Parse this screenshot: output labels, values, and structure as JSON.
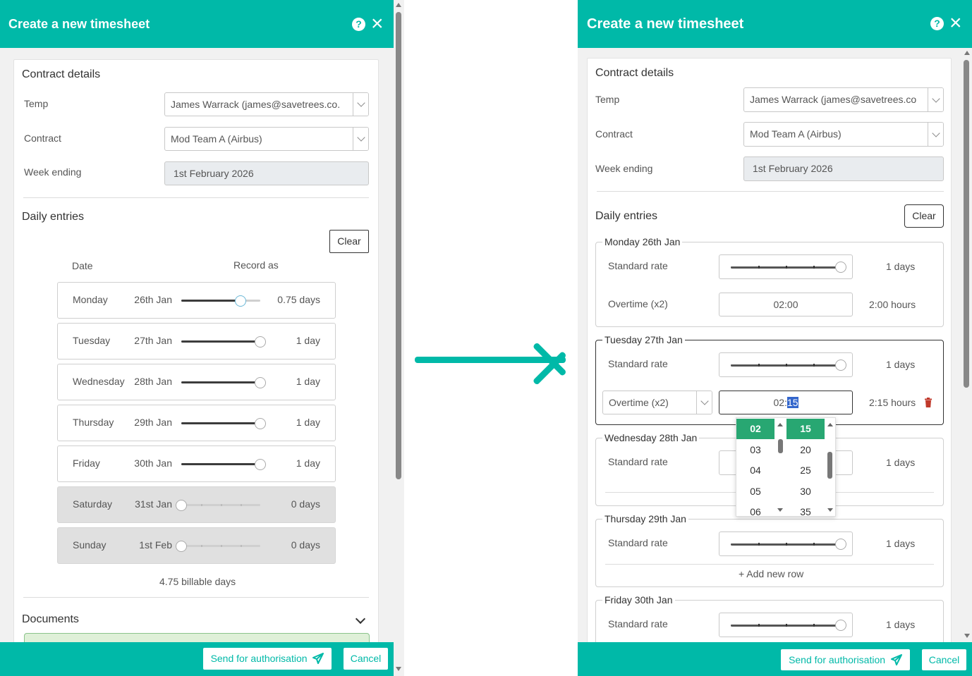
{
  "left": {
    "title": "Create a new timesheet",
    "help_icon": "?",
    "close_icon": "×",
    "contract_details": {
      "heading": "Contract details",
      "temp_label": "Temp",
      "temp_value": "James Warrack (james@savetrees.co.",
      "contract_label": "Contract",
      "contract_value": "Mod Team A (Airbus)",
      "week_label": "Week ending",
      "week_value": "1st February 2026"
    },
    "daily": {
      "heading": "Daily entries",
      "clear_label": "Clear",
      "col_date": "Date",
      "col_record": "Record as",
      "rows": [
        {
          "day": "Monday",
          "date": "26th Jan",
          "value": "0.75 days",
          "fraction": 0.75,
          "off": false
        },
        {
          "day": "Tuesday",
          "date": "27th Jan",
          "value": "1 day",
          "fraction": 1,
          "off": false
        },
        {
          "day": "Wednesday",
          "date": "28th Jan",
          "value": "1 day",
          "fraction": 1,
          "off": false
        },
        {
          "day": "Thursday",
          "date": "29th Jan",
          "value": "1 day",
          "fraction": 1,
          "off": false
        },
        {
          "day": "Friday",
          "date": "30th Jan",
          "value": "1 day",
          "fraction": 1,
          "off": false
        },
        {
          "day": "Saturday",
          "date": "31st Jan",
          "value": "0 days",
          "fraction": 0,
          "off": true
        },
        {
          "day": "Sunday",
          "date": "1st Feb",
          "value": "0 days",
          "fraction": 0,
          "off": true
        }
      ],
      "total": "4.75 billable days"
    },
    "documents_heading": "Documents",
    "send_label": "Send for authorisation",
    "cancel_label": "Cancel"
  },
  "right": {
    "title": "Create a new timesheet",
    "help_icon": "?",
    "close_icon": "×",
    "contract_details": {
      "heading": "Contract details",
      "temp_label": "Temp",
      "temp_value": "James Warrack (james@savetrees.co",
      "contract_label": "Contract",
      "contract_value": "Mod Team A (Airbus)",
      "week_label": "Week ending",
      "week_value": "1st February 2026"
    },
    "daily": {
      "heading": "Daily entries",
      "clear_label": "Clear",
      "monday": {
        "legend": "Monday 26th Jan",
        "standard_label": "Standard rate",
        "standard_value": "1 days",
        "standard_fraction": 1,
        "overtime_label": "Overtime (x2)",
        "overtime_time": "02:00",
        "overtime_value": "2:00 hours"
      },
      "tuesday": {
        "legend": "Tuesday 27th Jan",
        "standard_label": "Standard rate",
        "standard_value": "1 days",
        "standard_fraction": 1,
        "overtime_select": "Overtime (x2)",
        "time_hours": "02:",
        "time_minutes": "15",
        "overtime_value": "2:15 hours"
      },
      "wednesday": {
        "legend": "Wednesday 28th Jan",
        "standard_label": "Standard rate",
        "standard_value": "1 days"
      },
      "thursday": {
        "legend": "Thursday 29th Jan",
        "standard_label": "Standard rate",
        "standard_value": "1 days",
        "standard_fraction": 1,
        "add_row": "+ Add new row"
      },
      "friday": {
        "legend": "Friday 30th Jan",
        "standard_label": "Standard rate",
        "standard_value": "1 days",
        "standard_fraction": 1
      }
    },
    "time_picker": {
      "hours": [
        "02",
        "03",
        "04",
        "05",
        "06"
      ],
      "minutes": [
        "15",
        "20",
        "25",
        "30",
        "35"
      ]
    },
    "send_label": "Send for authorisation",
    "cancel_label": "Cancel"
  },
  "colors": {
    "brand": "#00b9a8",
    "picker_selected": "#28a772",
    "delete": "#c0392b"
  }
}
